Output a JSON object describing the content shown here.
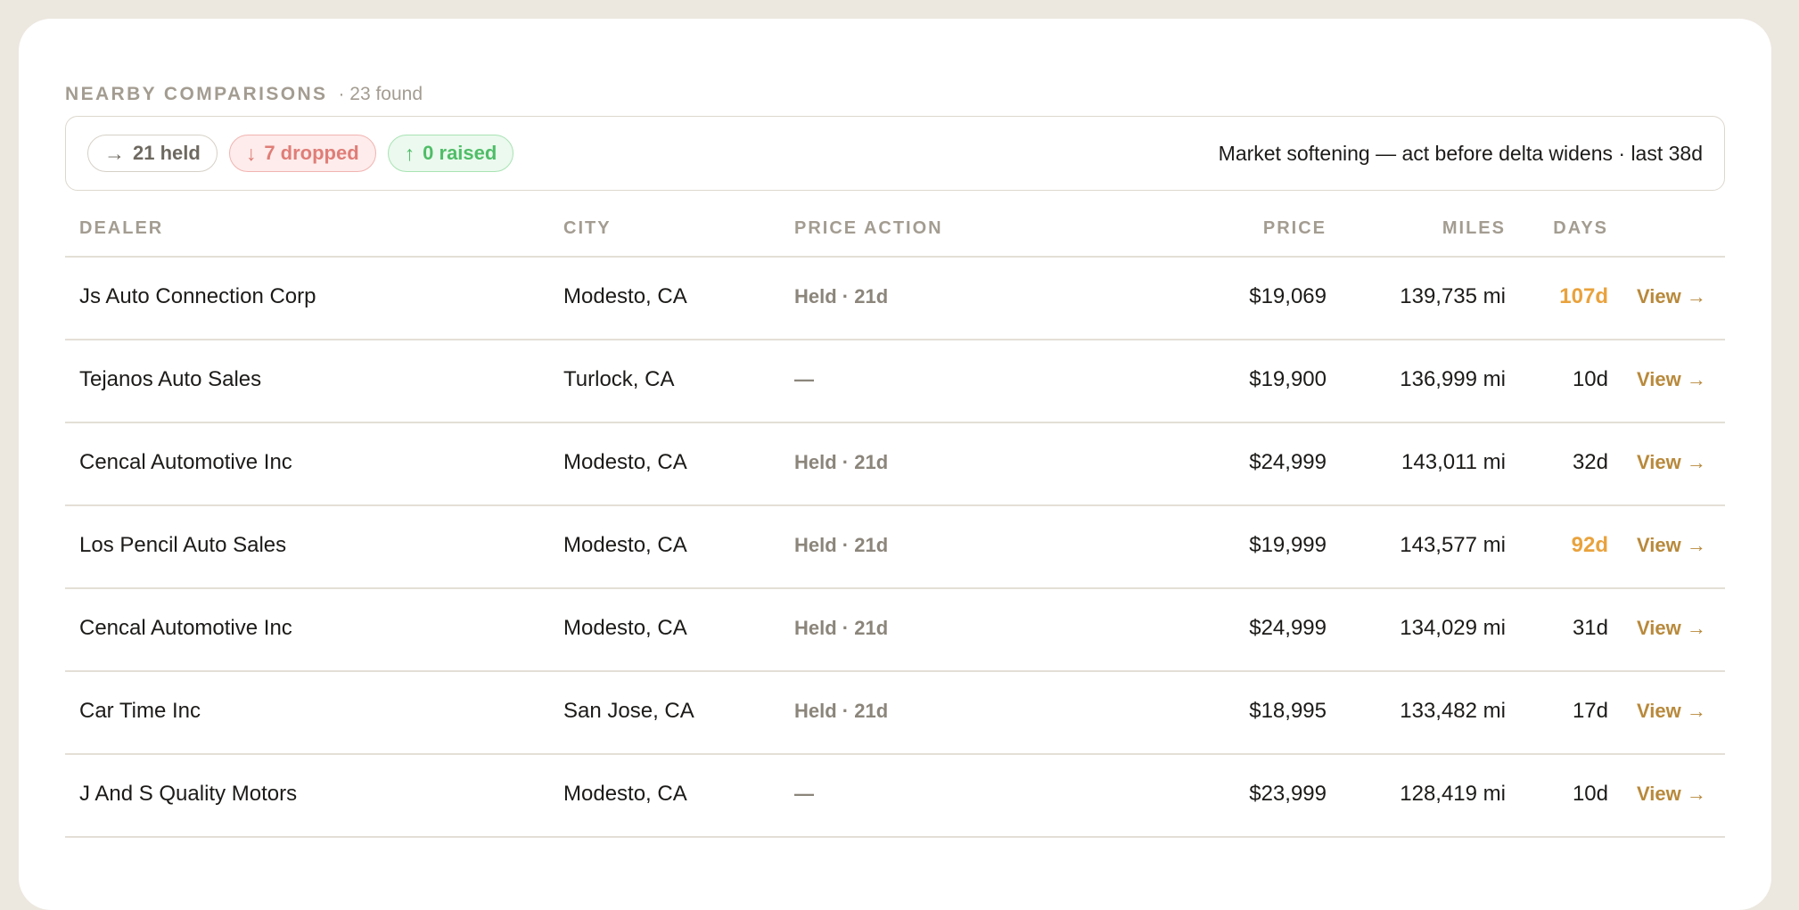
{
  "header": {
    "title": "NEARBY COMPARISONS",
    "count": "· 23 found"
  },
  "summary": {
    "pills": [
      {
        "icon": "arrow-right-icon",
        "glyph": "→",
        "label": "21 held"
      },
      {
        "icon": "arrow-down-icon",
        "glyph": "↓",
        "label": "7 dropped"
      },
      {
        "icon": "arrow-up-icon",
        "glyph": "↑",
        "label": "0 raised"
      }
    ],
    "note": "Market softening — act before delta widens · last 38d"
  },
  "columns": {
    "dealer": "DEALER",
    "city": "CITY",
    "price_action": "PRICE ACTION",
    "price": "PRICE",
    "miles": "MILES",
    "days": "DAYS"
  },
  "rows": [
    {
      "dealer": "Js Auto Connection Corp",
      "city": "Modesto, CA",
      "action": "Held · 21d",
      "price": "$19,069",
      "miles": "139,735 mi",
      "days": "107d",
      "days_highlight": true,
      "view": "View →"
    },
    {
      "dealer": "Tejanos Auto Sales",
      "city": "Turlock, CA",
      "action": "—",
      "price": "$19,900",
      "miles": "136,999 mi",
      "days": "10d",
      "days_highlight": false,
      "view": "View →"
    },
    {
      "dealer": "Cencal Automotive Inc",
      "city": "Modesto, CA",
      "action": "Held · 21d",
      "price": "$24,999",
      "miles": "143,011 mi",
      "days": "32d",
      "days_highlight": false,
      "view": "View →"
    },
    {
      "dealer": "Los Pencil Auto Sales",
      "city": "Modesto, CA",
      "action": "Held · 21d",
      "price": "$19,999",
      "miles": "143,577 mi",
      "days": "92d",
      "days_highlight": true,
      "view": "View →"
    },
    {
      "dealer": "Cencal Automotive Inc",
      "city": "Modesto, CA",
      "action": "Held · 21d",
      "price": "$24,999",
      "miles": "134,029 mi",
      "days": "31d",
      "days_highlight": false,
      "view": "View →"
    },
    {
      "dealer": "Car Time Inc",
      "city": "San Jose, CA",
      "action": "Held · 21d",
      "price": "$18,995",
      "miles": "133,482 mi",
      "days": "17d",
      "days_highlight": false,
      "view": "View →"
    },
    {
      "dealer": "J And S Quality Motors",
      "city": "Modesto, CA",
      "action": "—",
      "price": "$23,999",
      "miles": "128,419 mi",
      "days": "10d",
      "days_highlight": false,
      "view": "View →"
    }
  ],
  "colors": {
    "accent_view": "#b8893b",
    "days_highlight": "#e9a23c",
    "dropped": "#e07d77",
    "raised": "#4fbd67",
    "background": "#ece7df"
  }
}
